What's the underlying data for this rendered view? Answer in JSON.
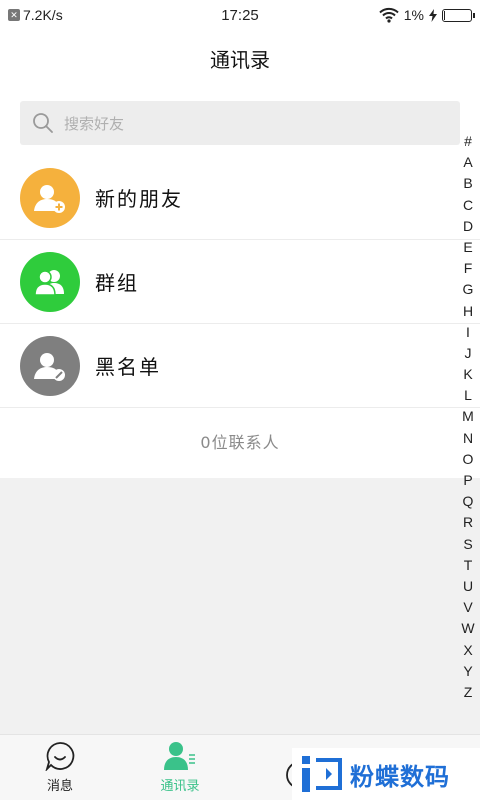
{
  "status": {
    "net_speed": "7.2K/s",
    "time": "17:25",
    "battery": "1%"
  },
  "header": {
    "title": "通讯录"
  },
  "search": {
    "placeholder": "搜索好友"
  },
  "items": [
    {
      "label": "新的朋友",
      "icon": "add-friend-icon",
      "color": "#f5b13d"
    },
    {
      "label": "群组",
      "icon": "group-icon",
      "color": "#2fcc3c"
    },
    {
      "label": "黑名单",
      "icon": "blacklist-icon",
      "color": "#7f7f7f"
    }
  ],
  "contact_count": "0位联系人",
  "index_letters": [
    "#",
    "A",
    "B",
    "C",
    "D",
    "E",
    "F",
    "G",
    "H",
    "I",
    "J",
    "K",
    "L",
    "M",
    "N",
    "O",
    "P",
    "Q",
    "R",
    "S",
    "T",
    "U",
    "V",
    "W",
    "X",
    "Y",
    "Z"
  ],
  "tabs": [
    {
      "label": "消息",
      "icon": "message-icon"
    },
    {
      "label": "通讯录",
      "icon": "contacts-icon",
      "active": true
    },
    {
      "label": "",
      "icon": "discover-icon"
    },
    {
      "label": "",
      "icon": "me-icon"
    }
  ],
  "watermark": {
    "text": "粉蝶数码",
    "color": "#1f6fd6"
  }
}
